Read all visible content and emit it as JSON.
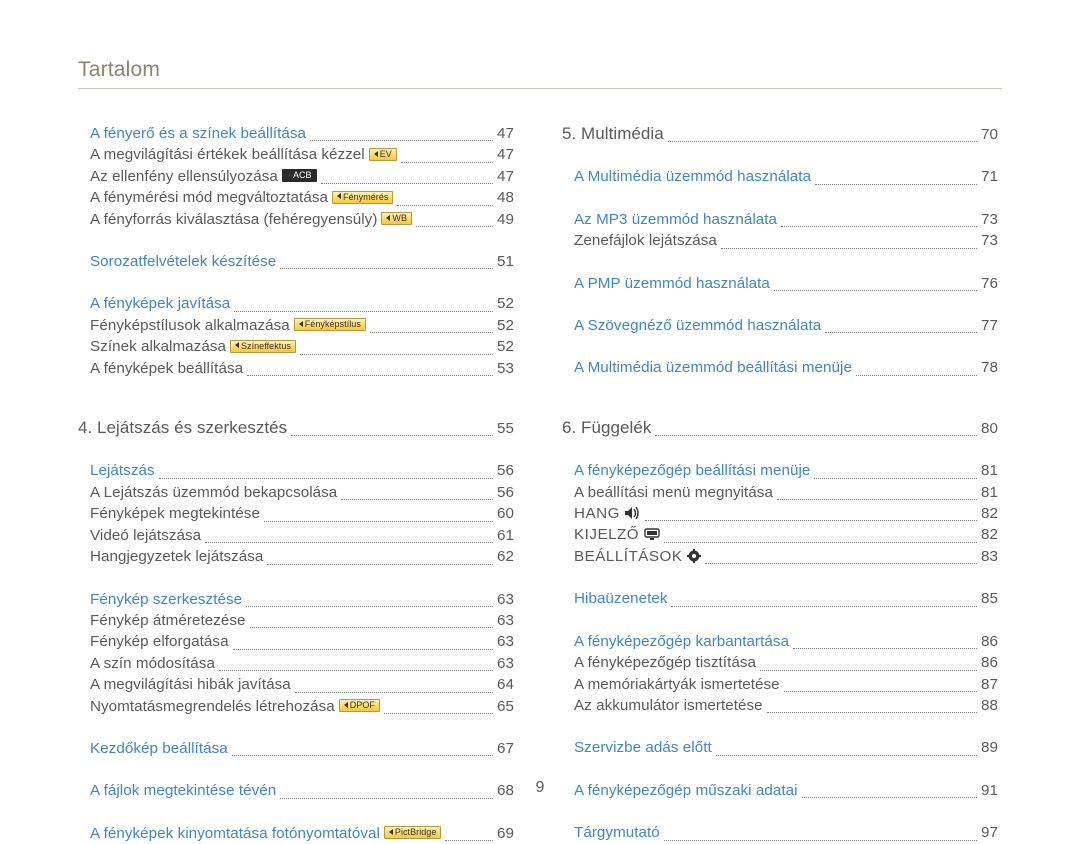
{
  "header": "Tartalom",
  "page_number": "9",
  "left": [
    {
      "kind": "link",
      "indent": true,
      "label": "A fényerő és a színek beállítása",
      "page": "47"
    },
    {
      "kind": "sub",
      "indent": true,
      "label": "A megvilágítási értékek beállítása kézzel",
      "badge": {
        "text": "EV",
        "arrow": true
      },
      "page": "47"
    },
    {
      "kind": "sub",
      "indent": true,
      "label": "Az ellenfény ellensúlyozása",
      "badge": {
        "text": "ACB",
        "arrow": true,
        "dark": true
      },
      "page": "47"
    },
    {
      "kind": "sub",
      "indent": true,
      "label": "A fénymérési mód megváltoztatása",
      "badge": {
        "text": "Fénymérés",
        "arrow": true
      },
      "page": "48"
    },
    {
      "kind": "sub",
      "indent": true,
      "label": "A fényforrás kiválasztása (fehéregyensúly)",
      "badge": {
        "text": "WB",
        "arrow": true
      },
      "page": "49"
    },
    {
      "kind": "gap"
    },
    {
      "kind": "link",
      "indent": true,
      "label": "Sorozatfelvételek készítése",
      "page": "51"
    },
    {
      "kind": "gap"
    },
    {
      "kind": "link",
      "indent": true,
      "label": "A fényképek javítása",
      "page": "52"
    },
    {
      "kind": "sub",
      "indent": true,
      "label": "Fényképstílusok alkalmazása",
      "badge": {
        "text": "Fényképstílus",
        "arrow": true
      },
      "page": "52"
    },
    {
      "kind": "sub",
      "indent": true,
      "label": "Színek alkalmazása",
      "badge": {
        "text": "Színeffektus",
        "arrow": true
      },
      "page": "52"
    },
    {
      "kind": "sub",
      "indent": true,
      "label": "A fényképek beállítása",
      "page": "53"
    },
    {
      "kind": "gap-lg"
    },
    {
      "kind": "section",
      "indent": false,
      "label": "4. Lejátszás és szerkesztés",
      "page": "55"
    },
    {
      "kind": "gap"
    },
    {
      "kind": "link",
      "indent": true,
      "label": "Lejátszás",
      "page": "56"
    },
    {
      "kind": "sub",
      "indent": true,
      "label": "A Lejátszás üzemmód bekapcsolása",
      "page": "56"
    },
    {
      "kind": "sub",
      "indent": true,
      "label": "Fényképek megtekintése",
      "page": "60"
    },
    {
      "kind": "sub",
      "indent": true,
      "label": "Videó lejátszása",
      "page": "61"
    },
    {
      "kind": "sub",
      "indent": true,
      "label": "Hangjegyzetek lejátszása",
      "page": "62"
    },
    {
      "kind": "gap"
    },
    {
      "kind": "link",
      "indent": true,
      "label": "Fénykép szerkesztése",
      "page": "63"
    },
    {
      "kind": "sub",
      "indent": true,
      "label": "Fénykép átméretezése",
      "page": "63"
    },
    {
      "kind": "sub",
      "indent": true,
      "label": "Fénykép elforgatása",
      "page": "63"
    },
    {
      "kind": "sub",
      "indent": true,
      "label": "A szín módosítása",
      "page": "63"
    },
    {
      "kind": "sub",
      "indent": true,
      "label": "A megvilágítási hibák javítása",
      "page": "64"
    },
    {
      "kind": "sub",
      "indent": true,
      "label": "Nyomtatásmegrendelés létrehozása",
      "badge": {
        "text": "DPOF",
        "arrow": true
      },
      "page": "65"
    },
    {
      "kind": "gap"
    },
    {
      "kind": "link",
      "indent": true,
      "label": "Kezdőkép beállítása",
      "page": "67"
    },
    {
      "kind": "gap"
    },
    {
      "kind": "link",
      "indent": true,
      "label": "A fájlok megtekintése tévén",
      "page": "68"
    },
    {
      "kind": "gap"
    },
    {
      "kind": "link",
      "indent": true,
      "label": "A fényképek kinyomtatása fotónyomtatóval",
      "badge": {
        "text": "PictBridge",
        "arrow": true
      },
      "page": "69"
    }
  ],
  "right": [
    {
      "kind": "section",
      "indent": false,
      "label": "5. Multimédia",
      "page": "70"
    },
    {
      "kind": "gap"
    },
    {
      "kind": "link",
      "indent": true,
      "label": "A Multimédia üzemmód használata",
      "page": "71"
    },
    {
      "kind": "gap"
    },
    {
      "kind": "link",
      "indent": true,
      "label": "Az MP3 üzemmód használata",
      "page": "73"
    },
    {
      "kind": "sub",
      "indent": true,
      "label": "Zenefájlok lejátszása",
      "page": "73"
    },
    {
      "kind": "gap"
    },
    {
      "kind": "link",
      "indent": true,
      "label": "A PMP üzemmód használata",
      "page": "76"
    },
    {
      "kind": "gap"
    },
    {
      "kind": "link",
      "indent": true,
      "label": "A Szövegnéző üzemmód használata",
      "page": "77"
    },
    {
      "kind": "gap"
    },
    {
      "kind": "link",
      "indent": true,
      "label": "A Multimédia üzemmód beállítási menüje",
      "page": "78"
    },
    {
      "kind": "gap-lg"
    },
    {
      "kind": "section",
      "indent": false,
      "label": "6. Függelék",
      "page": "80"
    },
    {
      "kind": "gap"
    },
    {
      "kind": "link",
      "indent": true,
      "label": "A fényképezőgép beállítási menüje",
      "page": "81"
    },
    {
      "kind": "sub",
      "indent": true,
      "label": "A beállítási menü megnyitása",
      "page": "81"
    },
    {
      "kind": "sub",
      "indent": true,
      "label": "HANG",
      "icon": "speaker",
      "smallcaps": true,
      "page": "82"
    },
    {
      "kind": "sub",
      "indent": true,
      "label": "KIJELZŐ",
      "icon": "monitor",
      "smallcaps": true,
      "page": "82"
    },
    {
      "kind": "sub",
      "indent": true,
      "label": "BEÁLLÍTÁSOK",
      "icon": "gear",
      "smallcaps": true,
      "page": "83"
    },
    {
      "kind": "gap"
    },
    {
      "kind": "link",
      "indent": true,
      "label": "Hibaüzenetek",
      "page": "85"
    },
    {
      "kind": "gap"
    },
    {
      "kind": "link",
      "indent": true,
      "label": "A fényképezőgép karbantartása",
      "page": "86"
    },
    {
      "kind": "sub",
      "indent": true,
      "label": "A fényképezőgép tisztítása",
      "page": "86"
    },
    {
      "kind": "sub",
      "indent": true,
      "label": "A memóriakártyák ismertetése",
      "page": "87"
    },
    {
      "kind": "sub",
      "indent": true,
      "label": "Az akkumulátor ismertetése",
      "page": "88"
    },
    {
      "kind": "gap"
    },
    {
      "kind": "link",
      "indent": true,
      "label": "Szervizbe adás előtt",
      "page": "89"
    },
    {
      "kind": "gap"
    },
    {
      "kind": "link",
      "indent": true,
      "label": "A fényképezőgép műszaki adatai",
      "page": "91"
    },
    {
      "kind": "gap"
    },
    {
      "kind": "link",
      "indent": true,
      "label": "Tárgymutató",
      "page": "97"
    }
  ]
}
